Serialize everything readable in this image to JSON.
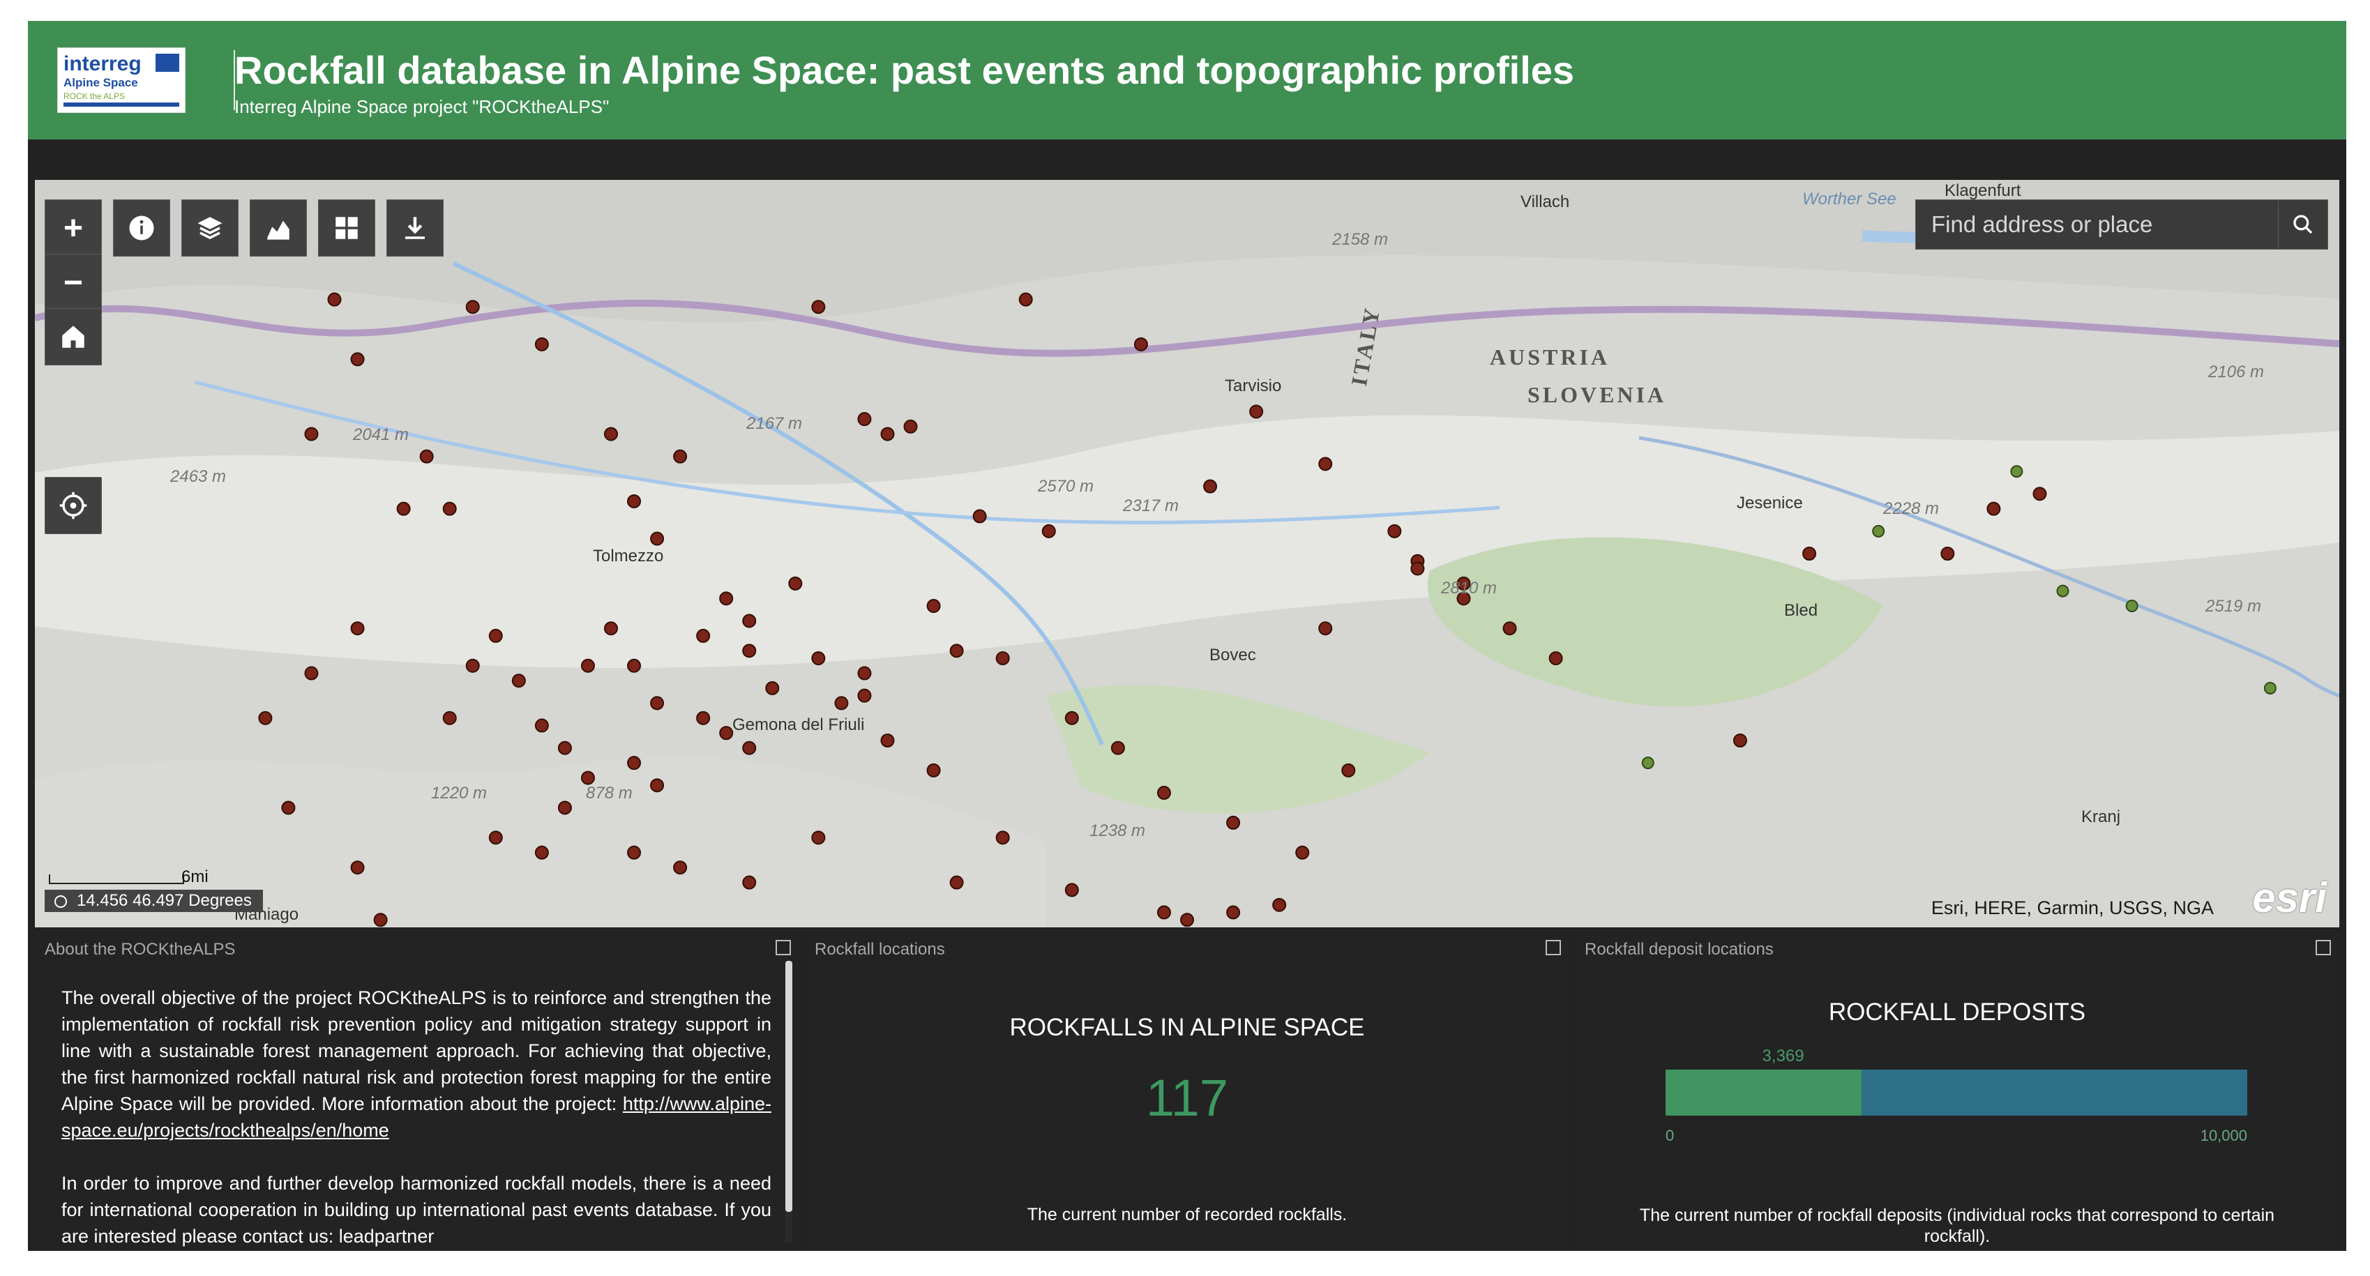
{
  "header": {
    "logo_line1": "interreg",
    "logo_line2": "Alpine Space",
    "logo_line3": "ROCK the ALPS",
    "title": "Rockfall database in Alpine Space: past events and topographic profiles",
    "subtitle": "Interreg Alpine Space project \"ROCKtheALPS\""
  },
  "map": {
    "search": {
      "placeholder": "Find address or place"
    },
    "attribution": "Esri, HERE, Garmin, USGS, NGA",
    "esri": "esri",
    "scale_label": "6mi",
    "coordinate": "14.456 46.497 Degrees",
    "places": [
      "Villach",
      "Tarvisio",
      "AUSTRIA",
      "SLOVENIA",
      "ITALY",
      "Tolmezzo",
      "Jesenice",
      "Bled",
      "Kranj",
      "Maniago",
      "Bovec",
      "Gemona del Friuli",
      "Worther See",
      "Klagenfurt"
    ],
    "heights": [
      "2158 m",
      "2167 m",
      "2463 m",
      "2041 m",
      "2570 m",
      "2317 m",
      "2810 m",
      "2228 m",
      "2519 m",
      "2106 m",
      "1220 m",
      "878 m",
      "1238 m"
    ],
    "icons": [
      "zoom-in-icon",
      "zoom-out-icon",
      "home-icon",
      "info-icon",
      "layers-icon",
      "chart-icon",
      "grid-icon",
      "download-icon",
      "locate-icon",
      "search-icon"
    ],
    "points": [
      [
        0.13,
        0.16
      ],
      [
        0.14,
        0.24
      ],
      [
        0.19,
        0.17
      ],
      [
        0.22,
        0.22
      ],
      [
        0.34,
        0.17
      ],
      [
        0.36,
        0.32
      ],
      [
        0.37,
        0.34
      ],
      [
        0.38,
        0.33
      ],
      [
        0.43,
        0.16
      ],
      [
        0.48,
        0.22
      ],
      [
        0.53,
        0.31
      ],
      [
        0.51,
        0.41
      ],
      [
        0.56,
        0.38
      ],
      [
        0.59,
        0.47
      ],
      [
        0.6,
        0.51
      ],
      [
        0.62,
        0.56
      ],
      [
        0.56,
        0.6
      ],
      [
        0.12,
        0.34
      ],
      [
        0.17,
        0.37
      ],
      [
        0.18,
        0.44
      ],
      [
        0.16,
        0.44
      ],
      [
        0.25,
        0.34
      ],
      [
        0.26,
        0.43
      ],
      [
        0.28,
        0.37
      ],
      [
        0.27,
        0.48
      ],
      [
        0.3,
        0.56
      ],
      [
        0.31,
        0.63
      ],
      [
        0.32,
        0.68
      ],
      [
        0.36,
        0.69
      ],
      [
        0.34,
        0.64
      ],
      [
        0.25,
        0.6
      ],
      [
        0.26,
        0.65
      ],
      [
        0.27,
        0.7
      ],
      [
        0.29,
        0.72
      ],
      [
        0.3,
        0.74
      ],
      [
        0.31,
        0.76
      ],
      [
        0.26,
        0.78
      ],
      [
        0.27,
        0.81
      ],
      [
        0.23,
        0.84
      ],
      [
        0.2,
        0.88
      ],
      [
        0.22,
        0.9
      ],
      [
        0.18,
        0.72
      ],
      [
        0.14,
        0.6
      ],
      [
        0.12,
        0.66
      ],
      [
        0.1,
        0.72
      ],
      [
        0.11,
        0.84
      ],
      [
        0.08,
        0.96
      ],
      [
        0.14,
        0.92
      ],
      [
        0.15,
        0.99
      ],
      [
        0.26,
        0.9
      ],
      [
        0.28,
        0.92
      ],
      [
        0.31,
        0.94
      ],
      [
        0.34,
        0.88
      ],
      [
        0.4,
        0.94
      ],
      [
        0.42,
        0.88
      ],
      [
        0.45,
        0.95
      ],
      [
        0.49,
        0.98
      ],
      [
        0.5,
        0.99
      ],
      [
        0.52,
        0.98
      ],
      [
        0.54,
        0.97
      ],
      [
        0.55,
        0.9
      ],
      [
        0.57,
        0.79
      ],
      [
        0.6,
        0.52
      ],
      [
        0.62,
        0.54
      ],
      [
        0.64,
        0.6
      ],
      [
        0.66,
        0.64
      ],
      [
        0.7,
        0.78
      ],
      [
        0.74,
        0.75
      ],
      [
        0.77,
        0.5
      ],
      [
        0.8,
        0.47
      ],
      [
        0.85,
        0.44
      ],
      [
        0.86,
        0.39
      ],
      [
        0.87,
        0.42
      ],
      [
        0.88,
        0.55
      ],
      [
        0.91,
        0.57
      ],
      [
        0.83,
        0.5
      ],
      [
        0.97,
        0.68
      ],
      [
        0.44,
        0.47
      ],
      [
        0.41,
        0.45
      ],
      [
        0.39,
        0.57
      ],
      [
        0.4,
        0.63
      ],
      [
        0.42,
        0.64
      ],
      [
        0.36,
        0.66
      ],
      [
        0.35,
        0.7
      ],
      [
        0.37,
        0.75
      ],
      [
        0.39,
        0.79
      ],
      [
        0.33,
        0.54
      ],
      [
        0.31,
        0.59
      ],
      [
        0.29,
        0.61
      ],
      [
        0.24,
        0.65
      ],
      [
        0.2,
        0.61
      ],
      [
        0.19,
        0.65
      ],
      [
        0.21,
        0.67
      ],
      [
        0.22,
        0.73
      ],
      [
        0.23,
        0.76
      ],
      [
        0.24,
        0.8
      ],
      [
        0.45,
        0.72
      ],
      [
        0.47,
        0.76
      ],
      [
        0.49,
        0.82
      ],
      [
        0.52,
        0.86
      ]
    ]
  },
  "about": {
    "title": "About the ROCKtheALPS",
    "paragraph1": "The overall objective of the project ROCKtheALPS is to reinforce and strengthen the implementation of rockfall risk prevention policy and mitigation strategy support in line with a sustainable forest management approach. For achieving that objective, the first harmonized rockfall natural risk and protection forest mapping for the entire Alpine Space will be provided. More information about the project: ",
    "link": "http://www.alpine-space.eu/projects/rockthealps/en/home",
    "paragraph2": "In order to improve and further develop harmonized rockfall models, there is a need for international cooperation in building up international past events database. If you are interested please contact us: leadpartner"
  },
  "locations": {
    "title": "Rockfall locations",
    "heading": "ROCKFALLS IN ALPINE SPACE",
    "value": "117",
    "description": "The current number of recorded rockfalls."
  },
  "deposits": {
    "title": "Rockfall deposit locations",
    "heading": "ROCKFALL DEPOSITS",
    "value_label": "3,369",
    "axis_min": "0",
    "axis_max": "10,000",
    "description": "The current number of rockfall deposits (individual rocks that correspond to certain rockfall)."
  },
  "chart_data": {
    "type": "bar",
    "categories": [
      "ROCKFALL DEPOSITS"
    ],
    "values": [
      3369
    ],
    "ylim": [
      0,
      10000
    ],
    "title": "ROCKFALL DEPOSITS"
  }
}
